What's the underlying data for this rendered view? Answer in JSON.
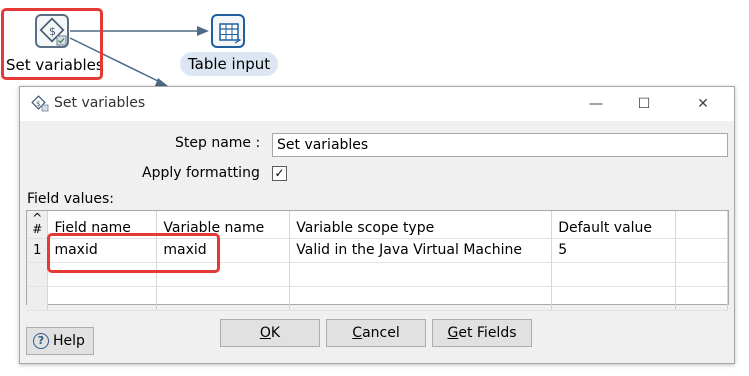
{
  "canvas": {
    "set_variables_label": "Set variables",
    "table_input_label": "Table input"
  },
  "dialog": {
    "title": "Set variables",
    "step_name_label": "Step name :",
    "step_name_value": "Set variables",
    "apply_formatting_label": "Apply formatting",
    "apply_formatting_checked": "✓",
    "field_values_label": "Field values:",
    "table": {
      "rownum_header": "#",
      "columns": [
        "Field name",
        "Variable name",
        "Variable scope type",
        "Default value"
      ],
      "rows": [
        {
          "num": "1",
          "field_name": "maxid",
          "variable_name": "maxid",
          "scope": "Valid in the Java Virtual Machine",
          "default": "5"
        }
      ]
    },
    "buttons": {
      "ok_u": "O",
      "ok_rest": "K",
      "cancel_u": "C",
      "cancel_rest": "ancel",
      "getfields_u": "G",
      "getfields_rest": "et Fields",
      "help": "Help"
    },
    "window_controls": {
      "minimize": "—",
      "maximize": "☐",
      "close": "✕"
    }
  },
  "icons": [
    "set-variables-icon",
    "table-input-icon",
    "help-icon",
    "checkbox-check-icon"
  ]
}
